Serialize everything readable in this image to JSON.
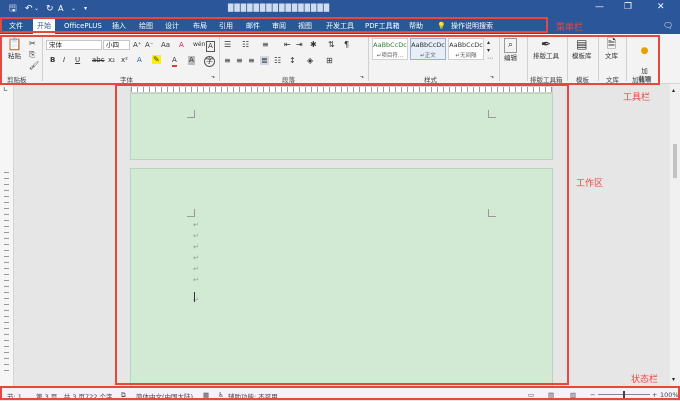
{
  "quick_access": {
    "save_icon": "save-icon",
    "undo_icon": "undo-icon",
    "redo_icon": "redo-icon",
    "customize_icon": "customize-icon"
  },
  "window": {
    "title_blurred": "████████████████",
    "minimize": "—",
    "restore": "❐",
    "close": "✕",
    "comment_icon": "comment-icon"
  },
  "menu": {
    "tabs": [
      "文件",
      "开始",
      "OfficePLUS",
      "插入",
      "绘图",
      "设计",
      "布局",
      "引用",
      "邮件",
      "审阅",
      "视图",
      "开发工具",
      "PDF工具箱",
      "帮助"
    ],
    "active_tab": "开始",
    "search_label": "操作说明搜索"
  },
  "ribbon": {
    "clipboard": {
      "paste_label": "粘贴",
      "group_label": "剪贴板"
    },
    "font": {
      "font_name": "宋体",
      "font_size": "小四",
      "group_label": "字体",
      "buttons": [
        "B",
        "I",
        "U",
        "abc",
        "x₂",
        "x²",
        "A",
        "A"
      ],
      "grow": "A⁺",
      "shrink": "A⁻",
      "case": "Aa",
      "clear": "A",
      "wen": "wén",
      "border_a": "A"
    },
    "paragraph": {
      "group_label": "段落"
    },
    "styles": {
      "group_label": "样式",
      "items": [
        {
          "sample": "AaBbCcDc",
          "name": "↵项目符..."
        },
        {
          "sample": "AaBbCcDc",
          "name": "↵正文"
        },
        {
          "sample": "AaBbCcDc",
          "name": "↵无间隔"
        }
      ]
    },
    "editing": {
      "label": "编辑",
      "group_label": ""
    },
    "tools": [
      {
        "label": "排版工具",
        "group": "排版工具箱"
      },
      {
        "label": "模板库",
        "group": "模板"
      },
      {
        "label": "文库",
        "group": "文库"
      },
      {
        "label": "加\n载项",
        "group": "加载项"
      }
    ]
  },
  "annotations": {
    "menu": "菜单栏",
    "toolbar": "工具栏",
    "workspace": "工作区",
    "statusbar": "状态栏"
  },
  "annotation_color": "#e8473d",
  "document": {
    "paragraph_mark": "↵",
    "paragraph_count": 7
  },
  "statusbar": {
    "section": "节: 1",
    "page": "第 3 页，共 3 页",
    "words": "722 个字",
    "language": "简体中文(中国大陆)",
    "accessibility": "辅助功能: 不可用",
    "zoom": "100%",
    "zoom_minus": "−",
    "zoom_plus": "+"
  },
  "colors": {
    "titlebar": "#2b579a",
    "page": "#d2e9d4"
  }
}
